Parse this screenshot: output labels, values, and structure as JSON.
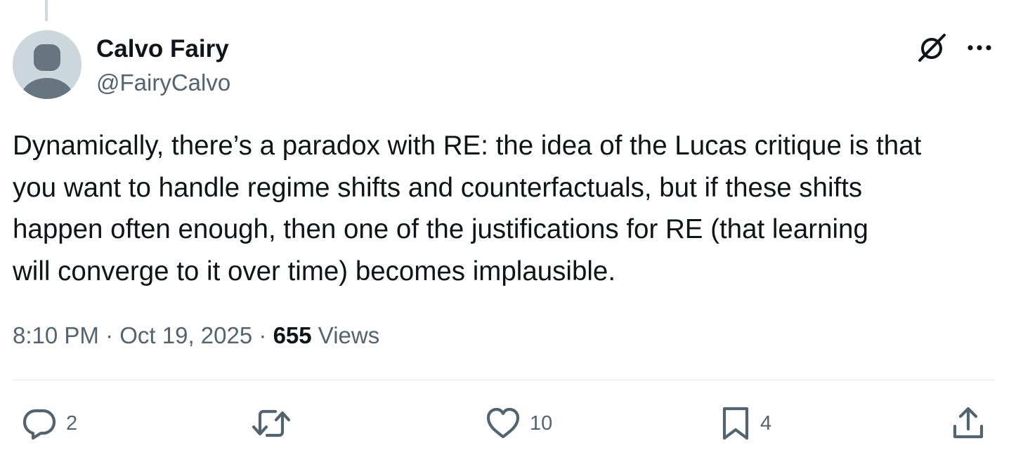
{
  "author": {
    "display_name": "Calvo Fairy",
    "handle": "@FairyCalvo"
  },
  "tweet": {
    "text": "Dynamically, there’s a paradox with RE: the idea of the Lucas critique is that\nyou want to handle regime shifts and counterfactuals, but if these shifts\nhappen often enough, then one of the justifications for RE (that learning\nwill converge to it over time) becomes implausible."
  },
  "meta": {
    "time": "8:10 PM",
    "separator": "·",
    "date": "Oct 19, 2025",
    "views_count": "655",
    "views_label": "Views"
  },
  "actions": {
    "replies": "2",
    "reposts": "",
    "likes": "10",
    "bookmarks": "4"
  },
  "icons": {
    "top_right": [
      "grok-icon",
      "more-icon"
    ],
    "actions": [
      "reply-icon",
      "repost-icon",
      "like-icon",
      "bookmark-icon",
      "share-icon"
    ]
  },
  "colors": {
    "text_primary": "#0f1419",
    "text_secondary": "#536471",
    "divider": "#eff3f4",
    "avatar_bg": "#ccd6dd",
    "avatar_fg": "#66757f"
  }
}
